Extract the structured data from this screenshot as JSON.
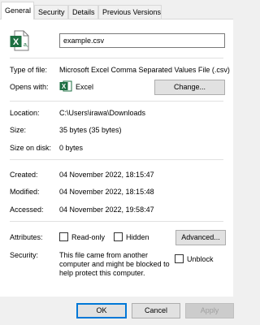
{
  "tabs": [
    "General",
    "Security",
    "Details",
    "Previous Versions"
  ],
  "file_name": "example.csv",
  "type_label": "Type of file:",
  "type_value": "Microsoft Excel Comma Separated Values File (.csv)",
  "opens_label": "Opens with:",
  "opens_value": "Excel",
  "change_button": "Change...",
  "location_label": "Location:",
  "location_value": "C:\\Users\\irawa\\Downloads",
  "size_label": "Size:",
  "size_value": "35 bytes (35 bytes)",
  "size_on_disk_label": "Size on disk:",
  "size_on_disk_value": "0 bytes",
  "created_label": "Created:",
  "created_value": "04 November 2022, 18:15:47",
  "modified_label": "Modified:",
  "modified_value": "04 November 2022, 18:15:48",
  "accessed_label": "Accessed:",
  "accessed_value": "04 November 2022, 19:58:47",
  "attributes_label": "Attributes:",
  "readonly_label": "Read-only",
  "hidden_label": "Hidden",
  "advanced_button": "Advanced...",
  "security_label": "Security:",
  "security_text_1": "This file came from another",
  "security_text_2": "computer and might be blocked to",
  "security_text_3": "help protect this computer.",
  "unblock_label": "Unblock",
  "ok_button": "OK",
  "cancel_button": "Cancel",
  "apply_button": "Apply",
  "icons": {
    "file": "excel-csv-file-icon",
    "app": "excel-app-icon"
  },
  "colors": {
    "excel_green": "#1d6f42",
    "accent": "#0078d7"
  }
}
